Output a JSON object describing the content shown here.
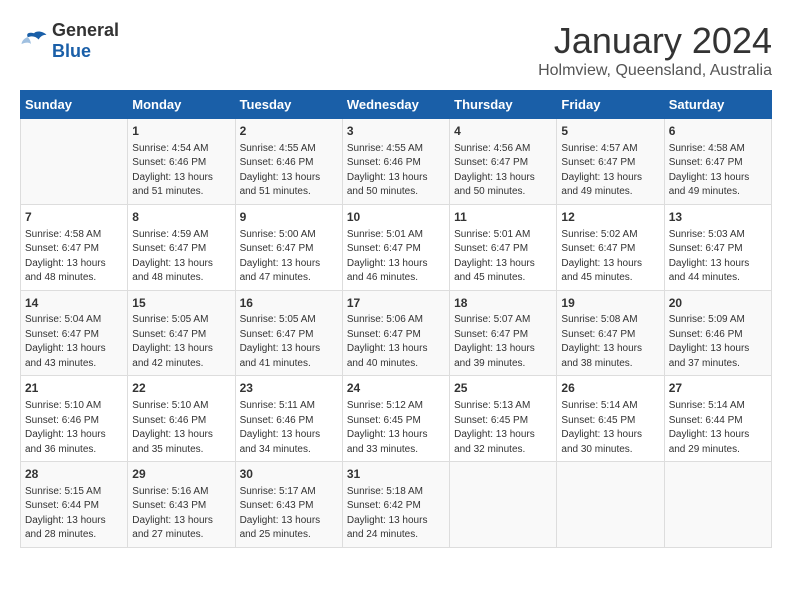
{
  "logo": {
    "general": "General",
    "blue": "Blue"
  },
  "title": "January 2024",
  "location": "Holmview, Queensland, Australia",
  "headers": [
    "Sunday",
    "Monday",
    "Tuesday",
    "Wednesday",
    "Thursday",
    "Friday",
    "Saturday"
  ],
  "weeks": [
    [
      {
        "day": "",
        "info": ""
      },
      {
        "day": "1",
        "info": "Sunrise: 4:54 AM\nSunset: 6:46 PM\nDaylight: 13 hours\nand 51 minutes."
      },
      {
        "day": "2",
        "info": "Sunrise: 4:55 AM\nSunset: 6:46 PM\nDaylight: 13 hours\nand 51 minutes."
      },
      {
        "day": "3",
        "info": "Sunrise: 4:55 AM\nSunset: 6:46 PM\nDaylight: 13 hours\nand 50 minutes."
      },
      {
        "day": "4",
        "info": "Sunrise: 4:56 AM\nSunset: 6:47 PM\nDaylight: 13 hours\nand 50 minutes."
      },
      {
        "day": "5",
        "info": "Sunrise: 4:57 AM\nSunset: 6:47 PM\nDaylight: 13 hours\nand 49 minutes."
      },
      {
        "day": "6",
        "info": "Sunrise: 4:58 AM\nSunset: 6:47 PM\nDaylight: 13 hours\nand 49 minutes."
      }
    ],
    [
      {
        "day": "7",
        "info": "Sunrise: 4:58 AM\nSunset: 6:47 PM\nDaylight: 13 hours\nand 48 minutes."
      },
      {
        "day": "8",
        "info": "Sunrise: 4:59 AM\nSunset: 6:47 PM\nDaylight: 13 hours\nand 48 minutes."
      },
      {
        "day": "9",
        "info": "Sunrise: 5:00 AM\nSunset: 6:47 PM\nDaylight: 13 hours\nand 47 minutes."
      },
      {
        "day": "10",
        "info": "Sunrise: 5:01 AM\nSunset: 6:47 PM\nDaylight: 13 hours\nand 46 minutes."
      },
      {
        "day": "11",
        "info": "Sunrise: 5:01 AM\nSunset: 6:47 PM\nDaylight: 13 hours\nand 45 minutes."
      },
      {
        "day": "12",
        "info": "Sunrise: 5:02 AM\nSunset: 6:47 PM\nDaylight: 13 hours\nand 45 minutes."
      },
      {
        "day": "13",
        "info": "Sunrise: 5:03 AM\nSunset: 6:47 PM\nDaylight: 13 hours\nand 44 minutes."
      }
    ],
    [
      {
        "day": "14",
        "info": "Sunrise: 5:04 AM\nSunset: 6:47 PM\nDaylight: 13 hours\nand 43 minutes."
      },
      {
        "day": "15",
        "info": "Sunrise: 5:05 AM\nSunset: 6:47 PM\nDaylight: 13 hours\nand 42 minutes."
      },
      {
        "day": "16",
        "info": "Sunrise: 5:05 AM\nSunset: 6:47 PM\nDaylight: 13 hours\nand 41 minutes."
      },
      {
        "day": "17",
        "info": "Sunrise: 5:06 AM\nSunset: 6:47 PM\nDaylight: 13 hours\nand 40 minutes."
      },
      {
        "day": "18",
        "info": "Sunrise: 5:07 AM\nSunset: 6:47 PM\nDaylight: 13 hours\nand 39 minutes."
      },
      {
        "day": "19",
        "info": "Sunrise: 5:08 AM\nSunset: 6:47 PM\nDaylight: 13 hours\nand 38 minutes."
      },
      {
        "day": "20",
        "info": "Sunrise: 5:09 AM\nSunset: 6:46 PM\nDaylight: 13 hours\nand 37 minutes."
      }
    ],
    [
      {
        "day": "21",
        "info": "Sunrise: 5:10 AM\nSunset: 6:46 PM\nDaylight: 13 hours\nand 36 minutes."
      },
      {
        "day": "22",
        "info": "Sunrise: 5:10 AM\nSunset: 6:46 PM\nDaylight: 13 hours\nand 35 minutes."
      },
      {
        "day": "23",
        "info": "Sunrise: 5:11 AM\nSunset: 6:46 PM\nDaylight: 13 hours\nand 34 minutes."
      },
      {
        "day": "24",
        "info": "Sunrise: 5:12 AM\nSunset: 6:45 PM\nDaylight: 13 hours\nand 33 minutes."
      },
      {
        "day": "25",
        "info": "Sunrise: 5:13 AM\nSunset: 6:45 PM\nDaylight: 13 hours\nand 32 minutes."
      },
      {
        "day": "26",
        "info": "Sunrise: 5:14 AM\nSunset: 6:45 PM\nDaylight: 13 hours\nand 30 minutes."
      },
      {
        "day": "27",
        "info": "Sunrise: 5:14 AM\nSunset: 6:44 PM\nDaylight: 13 hours\nand 29 minutes."
      }
    ],
    [
      {
        "day": "28",
        "info": "Sunrise: 5:15 AM\nSunset: 6:44 PM\nDaylight: 13 hours\nand 28 minutes."
      },
      {
        "day": "29",
        "info": "Sunrise: 5:16 AM\nSunset: 6:43 PM\nDaylight: 13 hours\nand 27 minutes."
      },
      {
        "day": "30",
        "info": "Sunrise: 5:17 AM\nSunset: 6:43 PM\nDaylight: 13 hours\nand 25 minutes."
      },
      {
        "day": "31",
        "info": "Sunrise: 5:18 AM\nSunset: 6:42 PM\nDaylight: 13 hours\nand 24 minutes."
      },
      {
        "day": "",
        "info": ""
      },
      {
        "day": "",
        "info": ""
      },
      {
        "day": "",
        "info": ""
      }
    ]
  ]
}
